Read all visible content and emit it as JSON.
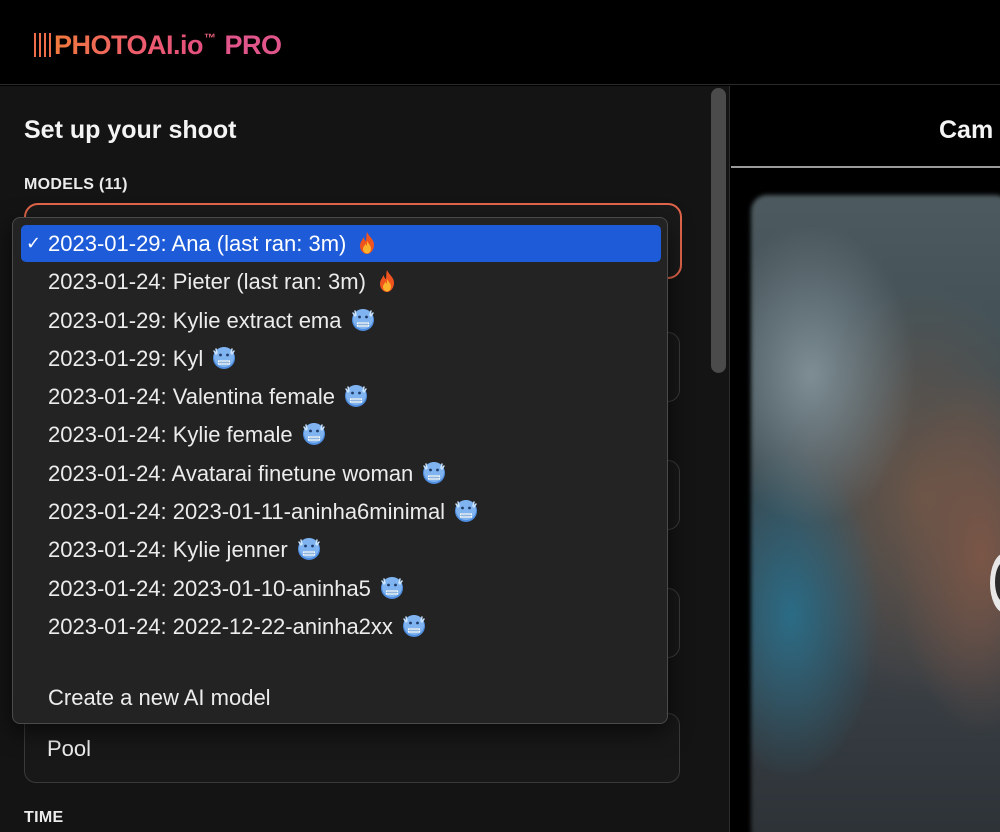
{
  "header": {
    "logo_text": "PHOTOAI.io",
    "logo_tm": "™",
    "logo_badge": "PRO"
  },
  "setup": {
    "title": "Set up your shoot",
    "models_label": "MODELS (11)",
    "pool_value": "Pool",
    "time_label": "TIME"
  },
  "dropdown": {
    "options": [
      {
        "label": "2023-01-29: Ana (last ran: 3m)",
        "icon": "fire-emoji-icon",
        "selected": true
      },
      {
        "label": "2023-01-24: Pieter (last ran: 3m)",
        "icon": "fire-emoji-icon"
      },
      {
        "label": "2023-01-29: Kylie extract ema",
        "icon": "cold-face-emoji-icon"
      },
      {
        "label": "2023-01-29: Kyl",
        "icon": "cold-face-emoji-icon"
      },
      {
        "label": "2023-01-24: Valentina female",
        "icon": "cold-face-emoji-icon"
      },
      {
        "label": "2023-01-24: Kylie female",
        "icon": "cold-face-emoji-icon"
      },
      {
        "label": "2023-01-24: Avatarai finetune woman",
        "icon": "cold-face-emoji-icon"
      },
      {
        "label": "2023-01-24: 2023-01-11-aninha6minimal",
        "icon": "cold-face-emoji-icon"
      },
      {
        "label": "2023-01-24: Kylie jenner",
        "icon": "cold-face-emoji-icon"
      },
      {
        "label": "2023-01-24: 2023-01-10-aninha5",
        "icon": "cold-face-emoji-icon"
      },
      {
        "label": "2023-01-24: 2022-12-22-aninha2xx",
        "icon": "cold-face-emoji-icon"
      }
    ],
    "create_label": "Create a new AI model",
    "check_mark": "✓"
  },
  "right": {
    "tab_label": "Cam"
  },
  "colors": {
    "accent": "#e2654b",
    "selected": "#1d5bd8"
  }
}
